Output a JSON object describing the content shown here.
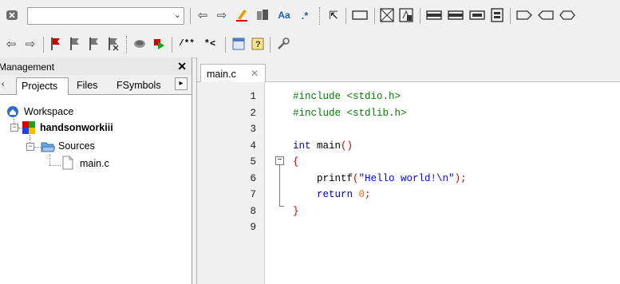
{
  "toolbar1": {
    "combo_value": "",
    "find_replace_label": ".*"
  },
  "panel": {
    "title": "Management",
    "close_glyph": "✕",
    "tabs": [
      {
        "label": "Projects"
      },
      {
        "label": "Files"
      },
      {
        "label": "FSymbols"
      }
    ],
    "scroll_glyph": "▸"
  },
  "tree": {
    "workspace": "Workspace",
    "project": "handsonworkiii",
    "folder": "Sources",
    "file": "main.c"
  },
  "editor": {
    "tab_label": "main.c",
    "tab_close": "✕",
    "line_numbers": [
      "1",
      "2",
      "3",
      "4",
      "5",
      "6",
      "7",
      "8",
      "9"
    ],
    "lines": [
      {
        "tokens": [
          {
            "t": "#include <stdio.h>",
            "c": "pre"
          }
        ]
      },
      {
        "tokens": [
          {
            "t": "#include <stdlib.h>",
            "c": "pre"
          }
        ]
      },
      {
        "tokens": []
      },
      {
        "tokens": [
          {
            "t": "int",
            "c": "kw"
          },
          {
            "t": " main",
            "c": "id"
          },
          {
            "t": "()",
            "c": "br"
          }
        ]
      },
      {
        "tokens": [
          {
            "t": "{",
            "c": "br"
          }
        ]
      },
      {
        "tokens": [
          {
            "t": "    printf",
            "c": "id"
          },
          {
            "t": "(",
            "c": "br"
          },
          {
            "t": "\"Hello world!\\n\"",
            "c": "str"
          },
          {
            "t": ");",
            "c": "br"
          }
        ]
      },
      {
        "tokens": [
          {
            "t": "    return",
            "c": "kw"
          },
          {
            "t": " ",
            "c": "id"
          },
          {
            "t": "0",
            "c": "num"
          },
          {
            "t": ";",
            "c": "br"
          }
        ]
      },
      {
        "tokens": [
          {
            "t": "}",
            "c": "br"
          }
        ]
      },
      {
        "tokens": []
      }
    ]
  },
  "colors": {
    "preprocessor": "#008000",
    "keyword": "#0000a0",
    "brace": "#cc0000",
    "string": "#0000ff",
    "number": "#ff6000"
  }
}
